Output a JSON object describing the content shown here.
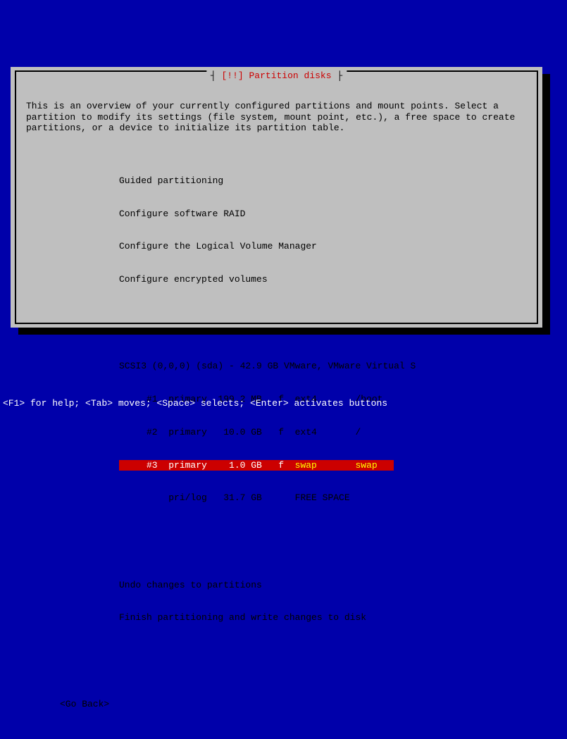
{
  "dialog": {
    "title_bang": "[!!]",
    "title_text": "Partition disks",
    "description": "This is an overview of your currently configured partitions and mount points. Select a partition to modify its settings (file system, mount point, etc.), a free space to create partitions, or a device to initialize its partition table.",
    "menu": {
      "guided": "Guided partitioning",
      "raid": "Configure software RAID",
      "lvm": "Configure the Logical Volume Manager",
      "encrypted": "Configure encrypted volumes"
    },
    "disk_header": "SCSI3 (0,0,0) (sda) - 42.9 GB VMware, VMware Virtual S",
    "partitions": {
      "p1": "     #1  primary  199.2 MB   f  ext4       /boot",
      "p2": "     #2  primary   10.0 GB   f  ext4       /",
      "p3_prefix": "     #3  primary    1.0 GB   f  ",
      "p3_swap1": "swap",
      "p3_mid": "       ",
      "p3_swap2": "swap",
      "p3_suffix": "   ",
      "free": "         pri/log   31.7 GB      FREE SPACE"
    },
    "actions": {
      "undo": "Undo changes to partitions",
      "finish": "Finish partitioning and write changes to disk"
    },
    "go_back": "<Go Back>"
  },
  "help_bar": "<F1> for help; <Tab> moves; <Space> selects; <Enter> activates buttons"
}
